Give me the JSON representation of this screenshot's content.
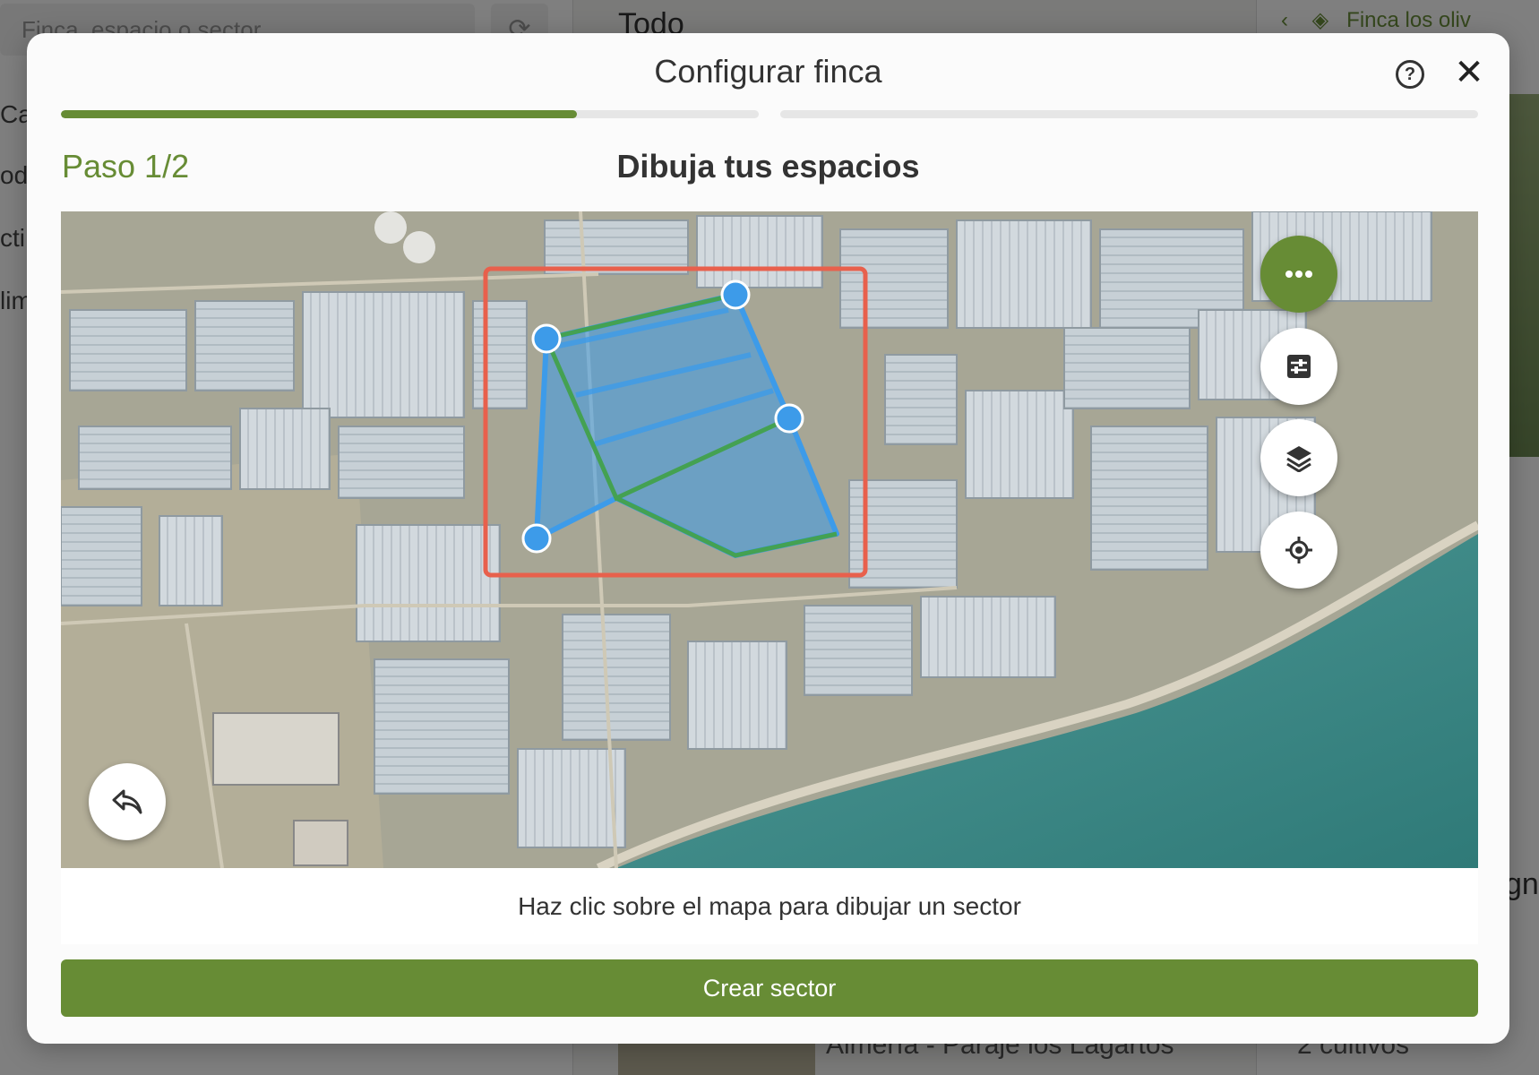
{
  "background": {
    "search_placeholder": "Finca, espacio o sector",
    "nav_items": [
      "Cat",
      "od",
      "cti",
      "lim"
    ],
    "middle_title": "Todo",
    "right_header": "Finca los oliv",
    "bottom_location": "Almería - Paraje los Lagartos",
    "bottom_cultivos": "2 cultivos",
    "right_text": "gn"
  },
  "modal": {
    "title": "Configurar finca",
    "help_icon": "help-circle-icon",
    "close_icon": "close-icon",
    "progress": [
      {
        "step": 1,
        "fill": 0.74
      },
      {
        "step": 2,
        "fill": 0
      }
    ],
    "step_label": "Paso 1/2",
    "step_title": "Dibuja tus espacios",
    "map": {
      "buttons": [
        {
          "name": "more-options-button",
          "icon": "more-horizontal-icon"
        },
        {
          "name": "adjust-button",
          "icon": "sliders-icon"
        },
        {
          "name": "layers-button",
          "icon": "layers-icon"
        },
        {
          "name": "locate-button",
          "icon": "crosshair-icon"
        },
        {
          "name": "undo-button",
          "icon": "undo-icon"
        }
      ],
      "polygon_vertices": 4,
      "colors": {
        "polygon": "#3d9be9",
        "edge": "#44a152",
        "highlight": "#e8604c"
      }
    },
    "instruction": "Haz clic sobre el mapa para dibujar un sector",
    "primary_button": "Crear sector"
  },
  "colors": {
    "accent": "#678c35",
    "track": "#e6e6e6"
  }
}
